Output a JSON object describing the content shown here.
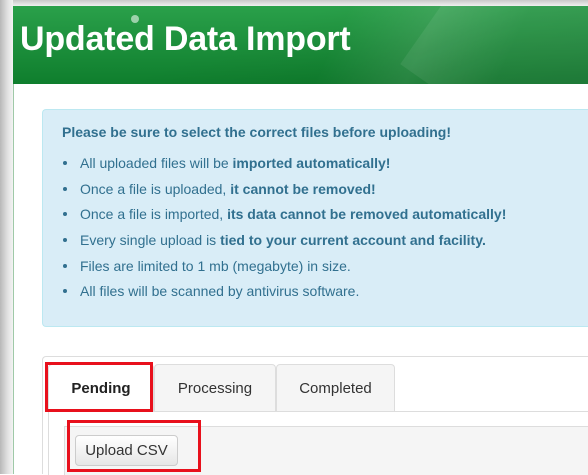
{
  "header": {
    "title": "Updated Data Import",
    "background_color": "#1a8d3a"
  },
  "alert": {
    "heading": "Please be sure to select the correct files before uploading!",
    "items": [
      {
        "text": "All uploaded files will be ",
        "emphasis": "imported automatically!"
      },
      {
        "text": "Once a file is uploaded, ",
        "emphasis": "it cannot be removed!"
      },
      {
        "text": "Once a file is imported, ",
        "emphasis": "its data cannot be removed automatically!"
      },
      {
        "text": "Every single upload is ",
        "emphasis": "tied to your current account and facility."
      },
      {
        "text": "Files are limited to 1 mb (megabyte) in size.",
        "emphasis": ""
      },
      {
        "text": "All files will be scanned by antivirus software.",
        "emphasis": ""
      }
    ],
    "background_color": "#d9edf7",
    "text_color": "#31708f"
  },
  "tabs": [
    {
      "label": "Pending",
      "active": true
    },
    {
      "label": "Processing",
      "active": false
    },
    {
      "label": "Completed",
      "active": false
    }
  ],
  "upload_button": {
    "label": "Upload CSV"
  },
  "highlight_color": "#e8101c"
}
